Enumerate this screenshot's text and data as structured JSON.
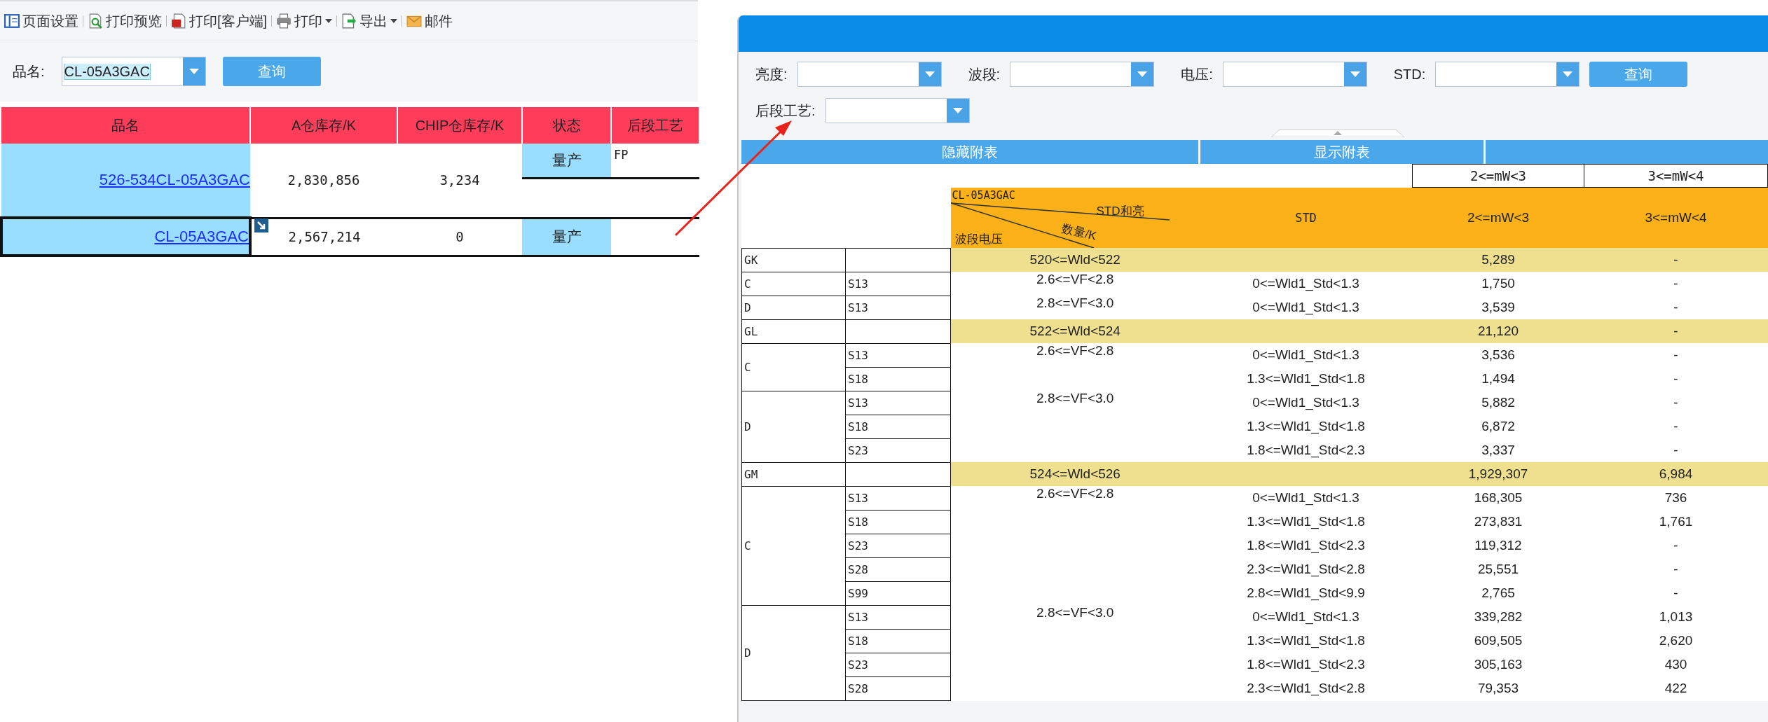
{
  "toolbar": [
    {
      "kind": "layout",
      "label": "页面设置",
      "dropdown": false
    },
    {
      "kind": "preview",
      "label": "打印预览",
      "dropdown": false
    },
    {
      "kind": "pdf",
      "label": "打印[客户端]",
      "dropdown": false
    },
    {
      "kind": "printer",
      "label": "打印",
      "dropdown": true
    },
    {
      "kind": "export",
      "label": "导出",
      "dropdown": true
    },
    {
      "kind": "mail",
      "label": "邮件",
      "dropdown": false
    }
  ],
  "query": {
    "label": "品名:",
    "value": "CL-05A3GAC",
    "button": "查询"
  },
  "main_table": {
    "columns": [
      "品名",
      "A仓库存/K",
      "CHIP仓库存/K",
      "状态",
      "后段工艺"
    ],
    "rows": [
      {
        "name": "526-534CL-05A3GAC",
        "a_stock": "2,830,856",
        "chip_stock": "3,234",
        "status": "量产",
        "process": "FP",
        "selected": false
      },
      {
        "name": "CL-05A3GAC",
        "a_stock": "2,567,214",
        "chip_stock": "0",
        "status": "量产",
        "process": "",
        "selected": true
      }
    ]
  },
  "dialog": {
    "filters": [
      {
        "label": "亮度:"
      },
      {
        "label": "波段:"
      },
      {
        "label": "电压:"
      },
      {
        "label": "STD:"
      },
      {
        "label": "后段工艺:"
      }
    ],
    "query_button": "查询",
    "bar_tabs": [
      "隐藏附表",
      "显示附表"
    ],
    "mw_boxes": [
      "2<=mW<3",
      "3<=mW<4"
    ],
    "header": {
      "title": "CL-05A3GAC",
      "top_label": "STD和亮",
      "middle_label": "数量/K",
      "bottom_label": "波段电压",
      "columns": [
        "STD",
        "2<=mW<3",
        "3<=mW<4"
      ]
    },
    "groups": [
      {
        "code": "GK",
        "range": "520<=Wld<522",
        "mw1": "5,289",
        "mw2": "-",
        "subgroups": [
          {
            "code": "C",
            "vf": "2.6<=VF<2.8",
            "rows": [
              {
                "s": "S13",
                "std": "0<=Wld1_Std<1.3",
                "mw1": "1,750",
                "mw2": "-"
              }
            ]
          },
          {
            "code": "D",
            "vf": "2.8<=VF<3.0",
            "rows": [
              {
                "s": "S13",
                "std": "0<=Wld1_Std<1.3",
                "mw1": "3,539",
                "mw2": "-"
              }
            ]
          }
        ]
      },
      {
        "code": "GL",
        "range": "522<=Wld<524",
        "mw1": "21,120",
        "mw2": "-",
        "subgroups": [
          {
            "code": "C",
            "vf": "2.6<=VF<2.8",
            "rows": [
              {
                "s": "S13",
                "std": "0<=Wld1_Std<1.3",
                "mw1": "3,536",
                "mw2": "-"
              },
              {
                "s": "S18",
                "std": "1.3<=Wld1_Std<1.8",
                "mw1": "1,494",
                "mw2": "-"
              }
            ]
          },
          {
            "code": "D",
            "vf": "2.8<=VF<3.0",
            "rows": [
              {
                "s": "S13",
                "std": "0<=Wld1_Std<1.3",
                "mw1": "5,882",
                "mw2": "-"
              },
              {
                "s": "S18",
                "std": "1.3<=Wld1_Std<1.8",
                "mw1": "6,872",
                "mw2": "-"
              },
              {
                "s": "S23",
                "std": "1.8<=Wld1_Std<2.3",
                "mw1": "3,337",
                "mw2": "-"
              }
            ]
          }
        ]
      },
      {
        "code": "GM",
        "range": "524<=Wld<526",
        "mw1": "1,929,307",
        "mw2": "6,984",
        "subgroups": [
          {
            "code": "C",
            "vf": "2.6<=VF<2.8",
            "rows": [
              {
                "s": "S13",
                "std": "0<=Wld1_Std<1.3",
                "mw1": "168,305",
                "mw2": "736"
              },
              {
                "s": "S18",
                "std": "1.3<=Wld1_Std<1.8",
                "mw1": "273,831",
                "mw2": "1,761"
              },
              {
                "s": "S23",
                "std": "1.8<=Wld1_Std<2.3",
                "mw1": "119,312",
                "mw2": "-"
              },
              {
                "s": "S28",
                "std": "2.3<=Wld1_Std<2.8",
                "mw1": "25,551",
                "mw2": "-"
              },
              {
                "s": "S99",
                "std": "2.8<=Wld1_Std<9.9",
                "mw1": "2,765",
                "mw2": "-"
              }
            ]
          },
          {
            "code": "D",
            "vf": "2.8<=VF<3.0",
            "rows": [
              {
                "s": "S13",
                "std": "0<=Wld1_Std<1.3",
                "mw1": "339,282",
                "mw2": "1,013"
              },
              {
                "s": "S18",
                "std": "1.3<=Wld1_Std<1.8",
                "mw1": "609,505",
                "mw2": "2,620"
              },
              {
                "s": "S23",
                "std": "1.8<=Wld1_Std<2.3",
                "mw1": "305,163",
                "mw2": "430"
              },
              {
                "s": "S28",
                "std": "2.3<=Wld1_Std<2.8",
                "mw1": "79,353",
                "mw2": "422"
              }
            ]
          }
        ]
      }
    ]
  }
}
